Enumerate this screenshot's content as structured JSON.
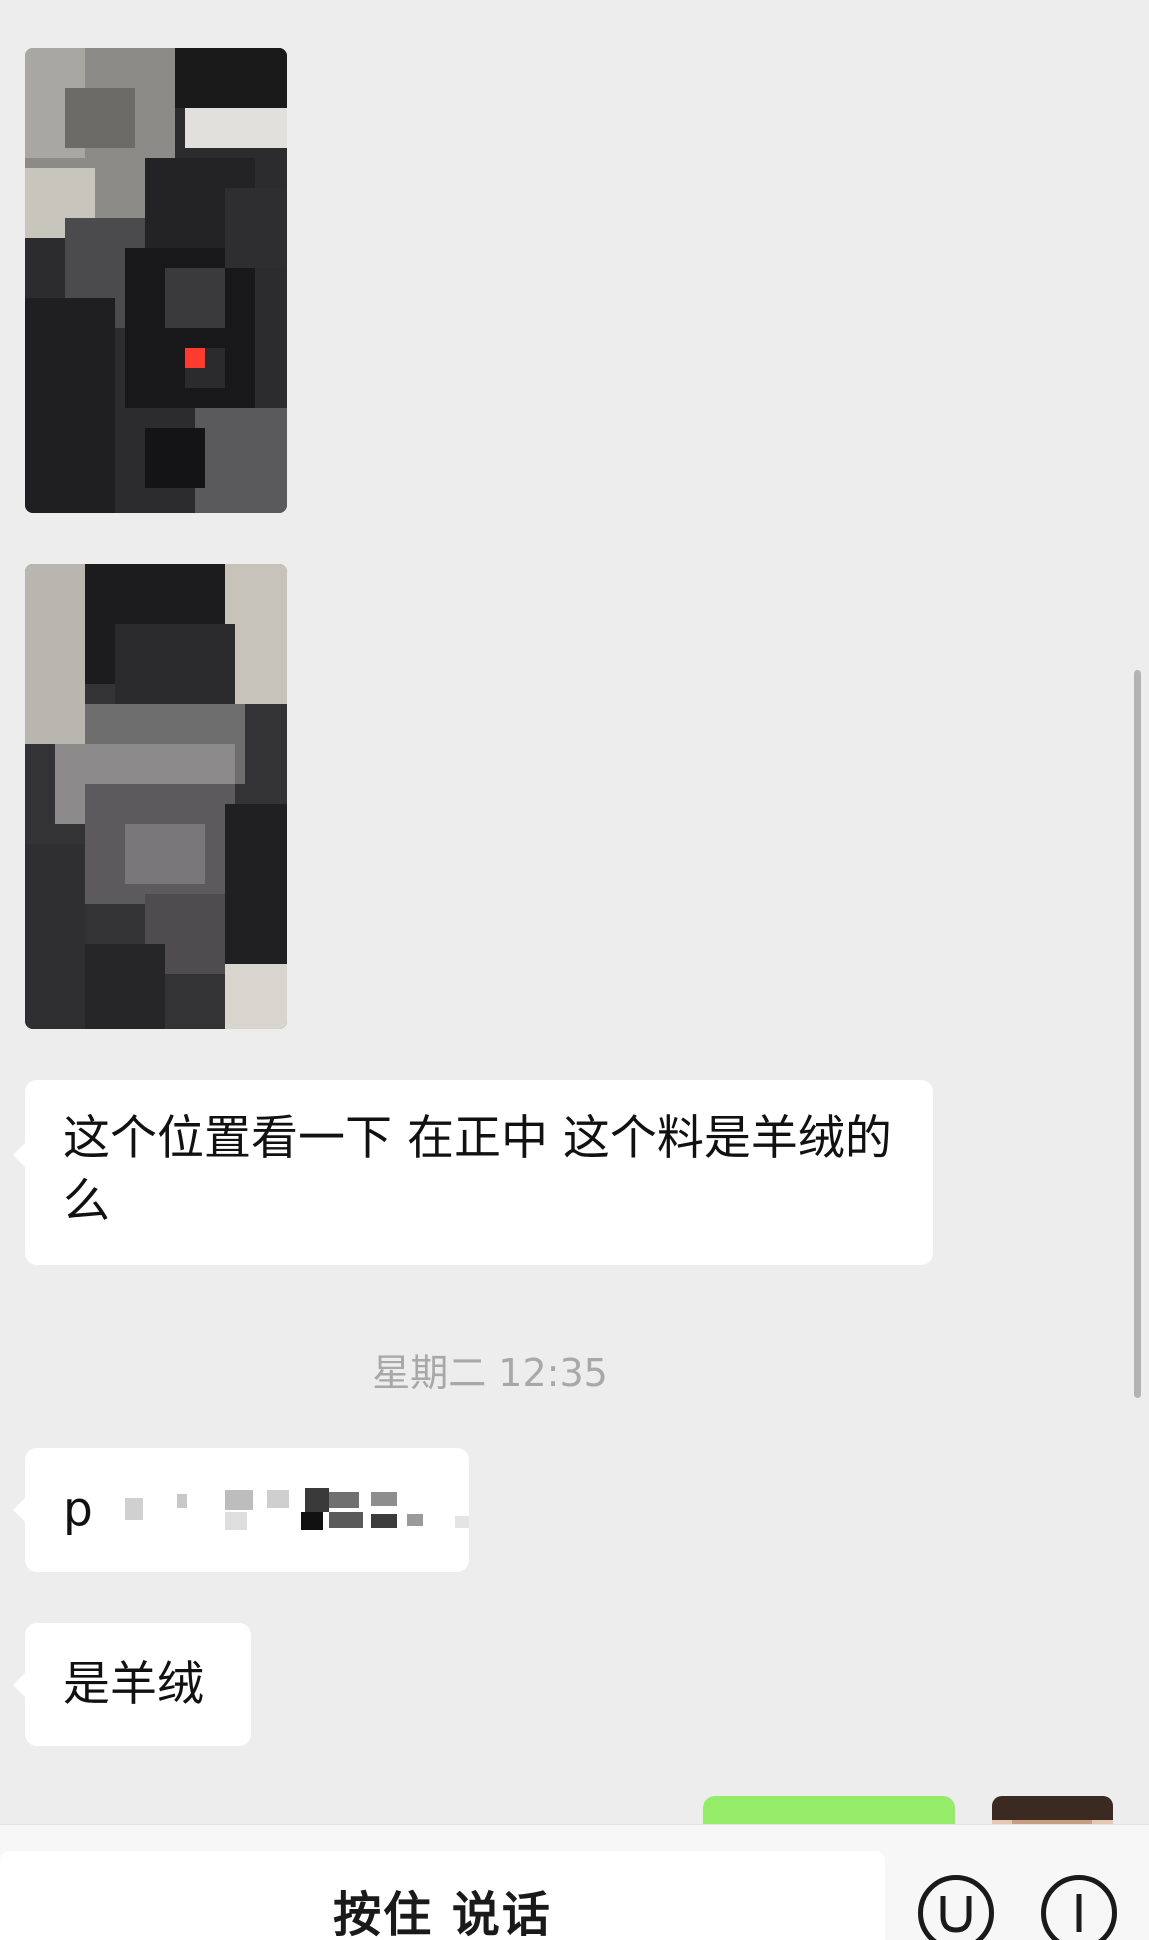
{
  "chat": {
    "messages": [
      {
        "type": "image",
        "direction": "incoming",
        "description_icon": "pixelated-photo"
      },
      {
        "type": "image",
        "direction": "incoming",
        "description_icon": "pixelated-photo"
      },
      {
        "type": "text",
        "direction": "incoming",
        "text": "这个位置看一下 在正中 这个料是羊绒的么"
      },
      {
        "type": "text",
        "direction": "incoming",
        "text": "p",
        "note_icon": "pixelated-text"
      },
      {
        "type": "text",
        "direction": "incoming",
        "text": "是羊绒"
      }
    ],
    "timestamp": "星期二 12:35"
  },
  "input_bar": {
    "hold_to_talk_label": "按住 说话",
    "emoji_icon": "smiley-icon",
    "more_icon": "plus-icon"
  },
  "colors": {
    "background": "#ededed",
    "incoming_bubble": "#ffffff",
    "outgoing_bubble": "#95ec69",
    "timestamp_text": "#a8a8a8"
  }
}
